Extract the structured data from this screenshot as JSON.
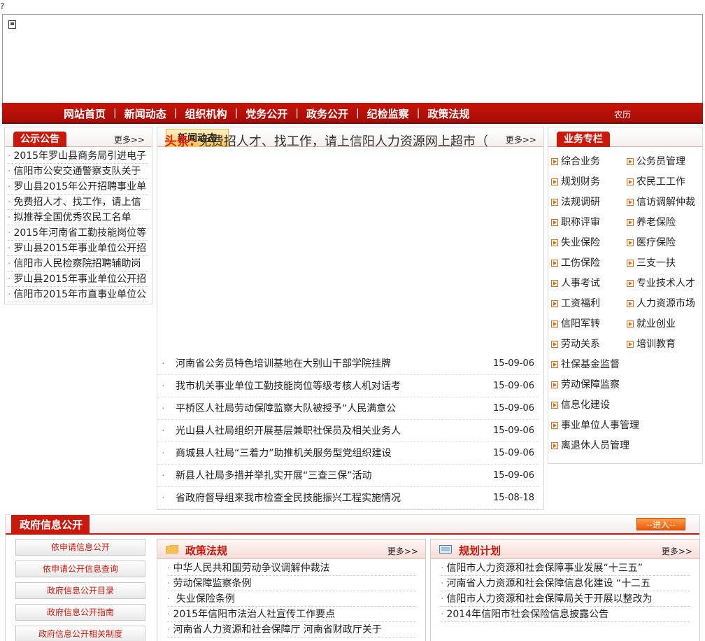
{
  "misc": {
    "qmark": "?"
  },
  "nav": {
    "items": [
      "网站首页",
      "新闻动态",
      "组织机构",
      "党务公开",
      "政务公开",
      "纪检监察",
      "政策法规"
    ],
    "calendar": "农历",
    "separator": "|"
  },
  "notice": {
    "title": "公示公告",
    "more": "更多>>",
    "items": [
      "2015年罗山县商务局引进电子",
      "信阳市公安交通警察支队关于",
      "罗山县2015年公开招聘事业单",
      "免费招人才、找工作，请上信",
      "拟推荐全国优秀农民工名单",
      "2015年河南省工勤技能岗位等",
      "罗山县2015年事业单位公开招",
      "信阳市人民检察院招聘辅助岗",
      "罗山县2015年事业单位公开招",
      "信阳市2015年市直事业单位公"
    ]
  },
  "news": {
    "title": "新闻动态",
    "more": "更多>>",
    "headline_label": "头条:",
    "headline_text": "免费招人才、找工作，请上信阳人力资源网上超市（",
    "items": [
      {
        "title": "河南省公务员特色培训基地在大别山干部学院挂牌",
        "date": "15-09-06"
      },
      {
        "title": "我市机关事业单位工勤技能岗位等级考核人机对话考",
        "date": "15-09-06"
      },
      {
        "title": "平桥区人社局劳动保障监察大队被授予“人民满意公",
        "date": "15-09-06"
      },
      {
        "title": "光山县人社局组织开展基层兼职社保员及相关业务人",
        "date": "15-09-06"
      },
      {
        "title": "商城县人社局“三着力”助推机关服务型党组织建设",
        "date": "15-09-06"
      },
      {
        "title": "新县人社局多措并举扎实开展“三查三保”活动",
        "date": "15-09-06"
      },
      {
        "title": "省政府督导组来我市检查全民技能振兴工程实施情况",
        "date": "15-08-18"
      }
    ]
  },
  "business": {
    "title": "业务专栏",
    "pairs": [
      [
        "综合业务",
        "公务员管理"
      ],
      [
        "规划财务",
        "农民工工作"
      ],
      [
        "法规调研",
        "信访调解仲裁"
      ],
      [
        "职称评审",
        "养老保险"
      ],
      [
        "失业保险",
        "医疗保险"
      ],
      [
        "工伤保险",
        "三支一扶"
      ],
      [
        "人事考试",
        "专业技术人才"
      ],
      [
        "工资福利",
        "人力资源市场"
      ],
      [
        "信阳军转",
        "就业创业"
      ],
      [
        "劳动关系",
        "培训教育"
      ]
    ],
    "singles": [
      "社保基金监督",
      "劳动保障监察",
      "信息化建设",
      "事业单位人事管理",
      "离退休人员管理"
    ]
  },
  "gov": {
    "title": "政府信息公开",
    "enter": "--进入--",
    "buttons": [
      "依申请信息公开",
      "依申请公开信息查询",
      "政府信息公开目录",
      "政府信息公开指南",
      "政府信息公开相关制度"
    ],
    "policy": {
      "title": "政策法规",
      "more": "更多>>",
      "items": [
        "中华人民共和国劳动争议调解仲裁法",
        "劳动保障监察条例",
        " 失业保险条例",
        "2015年信阳市法治人社宣传工作要点",
        "河南省人力资源和社会保障厅 河南省财政厅关于"
      ]
    },
    "plan": {
      "title": "规划计划",
      "more": "更多>>",
      "items": [
        "信阳市人力资源和社会保障事业发展“十三五”",
        "河南省人力资源和社会保障信息化建设 “十二五",
        "信阳市人力资源和社会保障局关于开展以整改为",
        "2014年信阳市社会保险信息披露公告"
      ]
    },
    "colors": {
      "accent": "#c9190c",
      "nav": "#b5100a"
    }
  }
}
